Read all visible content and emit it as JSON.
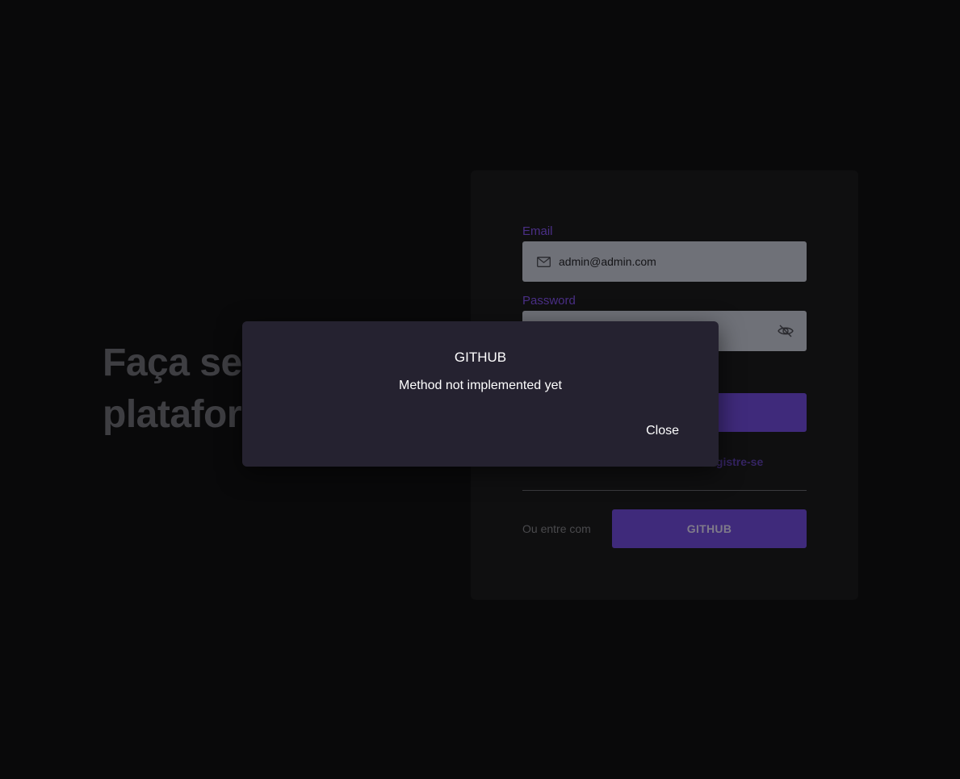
{
  "hero": {
    "line1": "Faça seu",
    "line2": "plataforma"
  },
  "login_form": {
    "email_label": "Email",
    "email_value": "admin@admin.com",
    "email_icon": "mail-icon",
    "password_label": "Password",
    "password_value": "",
    "password_toggle_icon": "eye-off-icon",
    "register_text": "Registre-se",
    "alt_login_text": "Ou entre com",
    "github_label": "GITHUB"
  },
  "modal": {
    "title": "GITHUB",
    "message": "Method not implemented yet",
    "close_label": "Close"
  },
  "colors": {
    "background": "#09090a",
    "card": "#0f0f10",
    "accent": "#3f2a7b",
    "modal": "#252230"
  }
}
